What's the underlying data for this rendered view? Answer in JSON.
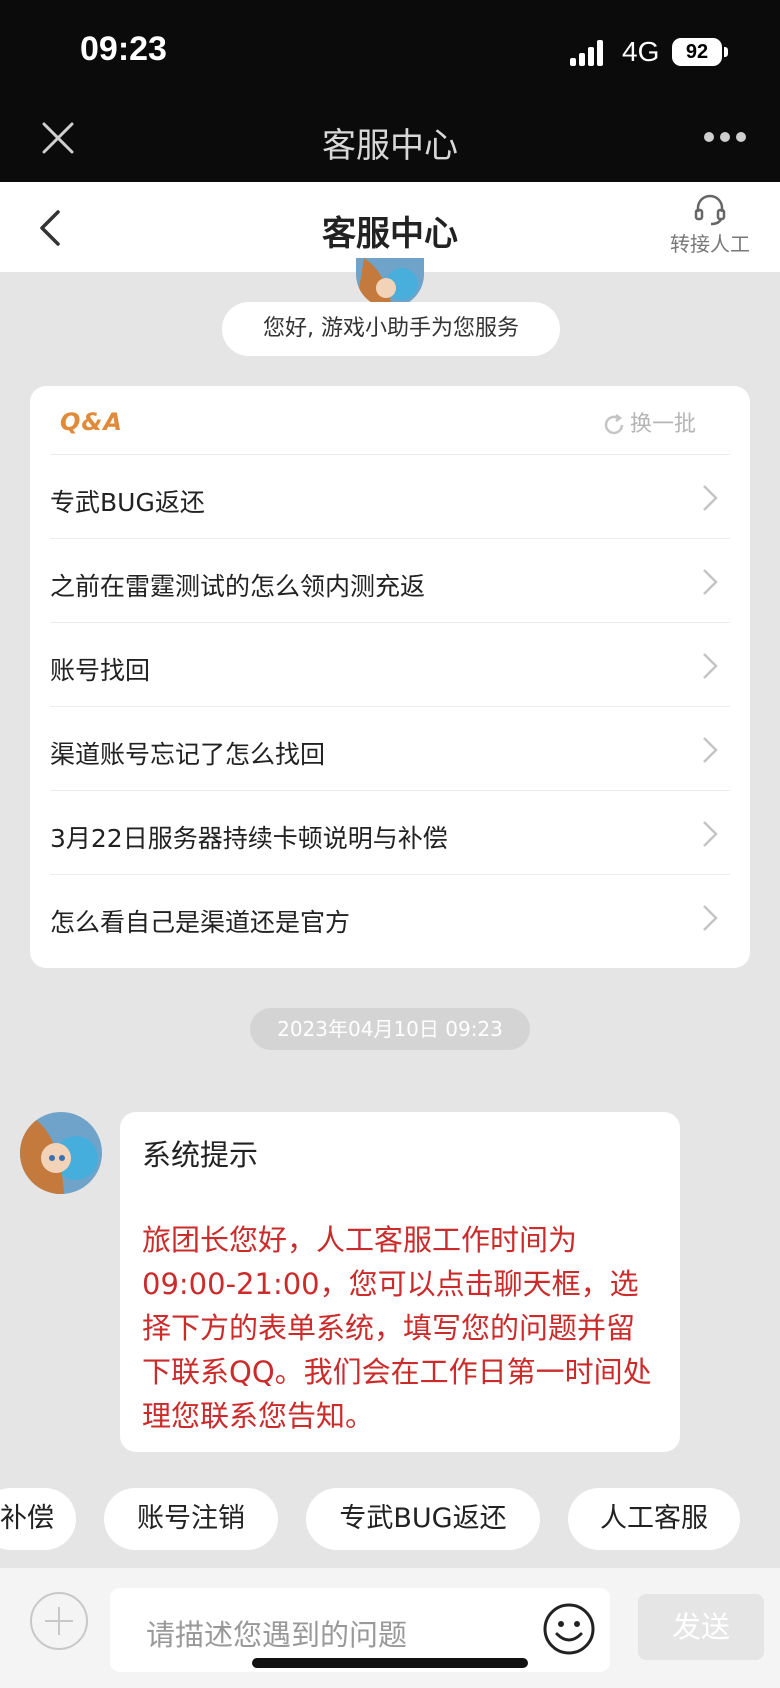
{
  "status_bar": {
    "time": "09:23",
    "network": "4G",
    "battery": "92"
  },
  "nav_bar": {
    "title": "客服中心"
  },
  "header": {
    "title": "客服中心",
    "transfer_label": "转接人工"
  },
  "greeting": {
    "text": "您好, 游戏小助手为您服务"
  },
  "qa": {
    "logo": "Q&A",
    "refresh_label": "换一批",
    "items": [
      {
        "label": "专武BUG返还"
      },
      {
        "label": "之前在雷霆测试的怎么领内测充返"
      },
      {
        "label": "账号找回"
      },
      {
        "label": "渠道账号忘记了怎么找回"
      },
      {
        "label": "3月22日服务器持续卡顿说明与补偿"
      },
      {
        "label": "怎么看自己是渠道还是官方"
      }
    ]
  },
  "timestamp": "2023年04月10日 09:23",
  "message": {
    "title": "系统提示",
    "body": "旅团长您好，人工客服工作时间为09:00-21:00，您可以点击聊天框，选择下方的表单系统，填写您的问题并留下联系QQ。我们会在工作日第一时间处理您联系您告知。"
  },
  "quick_replies": [
    {
      "label": "补偿"
    },
    {
      "label": "账号注销"
    },
    {
      "label": "专武BUG返还"
    },
    {
      "label": "人工客服"
    }
  ],
  "input": {
    "placeholder": "请描述您遇到的问题",
    "send_label": "发送"
  },
  "colors": {
    "accent_red": "#cc2b2b",
    "qa_logo": "#e08a3a",
    "background": "#e5e5e5"
  }
}
